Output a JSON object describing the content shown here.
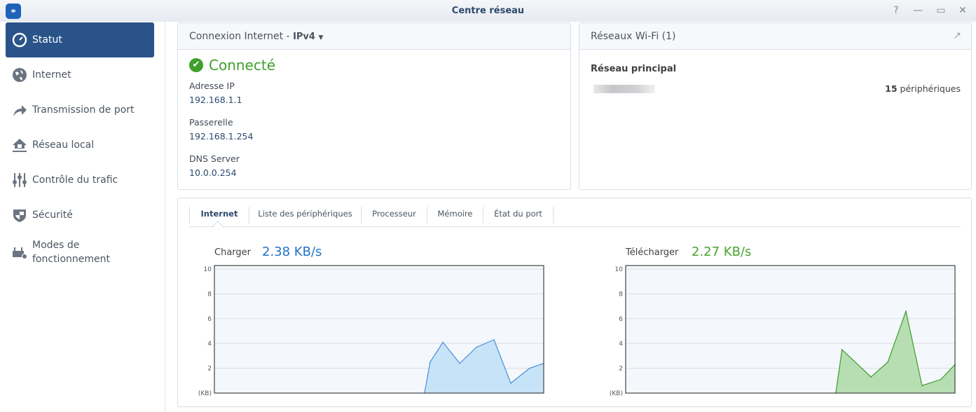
{
  "window": {
    "title": "Centre réseau",
    "help": "?",
    "minimize": "—",
    "maximize": "▭",
    "close": "✕"
  },
  "sidebar": {
    "items": [
      {
        "label": "Statut",
        "icon": "gauge-icon"
      },
      {
        "label": "Internet",
        "icon": "globe-icon"
      },
      {
        "label": "Transmission de port",
        "icon": "forward-arrow-icon"
      },
      {
        "label": "Réseau local",
        "icon": "home-network-icon"
      },
      {
        "label": "Contrôle du trafic",
        "icon": "sliders-icon"
      },
      {
        "label": "Sécurité",
        "icon": "shield-icon"
      },
      {
        "label": "Modes de fonctionnement",
        "icon": "router-gear-icon"
      }
    ]
  },
  "internet_panel": {
    "title": "Connexion Internet - ",
    "protocol": "IPv4",
    "status": "Connecté",
    "status_color": "#3fa02a",
    "fields": [
      {
        "label": "Adresse IP",
        "value": "192.168.1.1"
      },
      {
        "label": "Passerelle",
        "value": "192.168.1.254"
      },
      {
        "label": "DNS Server",
        "value": "10.0.0.254"
      }
    ]
  },
  "wifi_panel": {
    "title": "Réseaux Wi-Fi (1)",
    "network_label": "Réseau principal",
    "device_count": "15",
    "device_suffix": " périphériques"
  },
  "tabs": [
    "Internet",
    "Liste des périphériques",
    "Processeur",
    "Mémoire",
    "État du port"
  ],
  "chart_data": [
    {
      "type": "area",
      "title": "Charger",
      "current": "2.38 KB/s",
      "color": "#1f73c6",
      "line": "#4a8fd8",
      "fill": "#c6e3f8",
      "ylabel": "(KB)",
      "yticks": [
        2,
        4,
        6,
        8,
        10
      ],
      "ylim": [
        0,
        10.28
      ],
      "xlim": [
        0,
        100
      ],
      "x": [
        63.8,
        65.5,
        69.4,
        74.5,
        79.6,
        84.9,
        90,
        95.7,
        100
      ],
      "values": [
        0,
        2.5,
        4.1,
        2.4,
        3.7,
        4.3,
        0.8,
        2.0,
        2.4
      ]
    },
    {
      "type": "area",
      "title": "Télécharger",
      "current": "2.27 KB/s",
      "color": "#4aa22e",
      "line": "#3f9c2b",
      "fill": "#b6deb2",
      "ylabel": "(KB)",
      "yticks": [
        2,
        4,
        6,
        8,
        10
      ],
      "ylim": [
        0,
        10.28
      ],
      "xlim": [
        0,
        100
      ],
      "x": [
        63.8,
        65.7,
        74.5,
        79.6,
        85.1,
        90,
        95.7,
        100
      ],
      "values": [
        0,
        3.5,
        1.3,
        2.5,
        6.6,
        0.6,
        1.1,
        2.3
      ]
    }
  ]
}
